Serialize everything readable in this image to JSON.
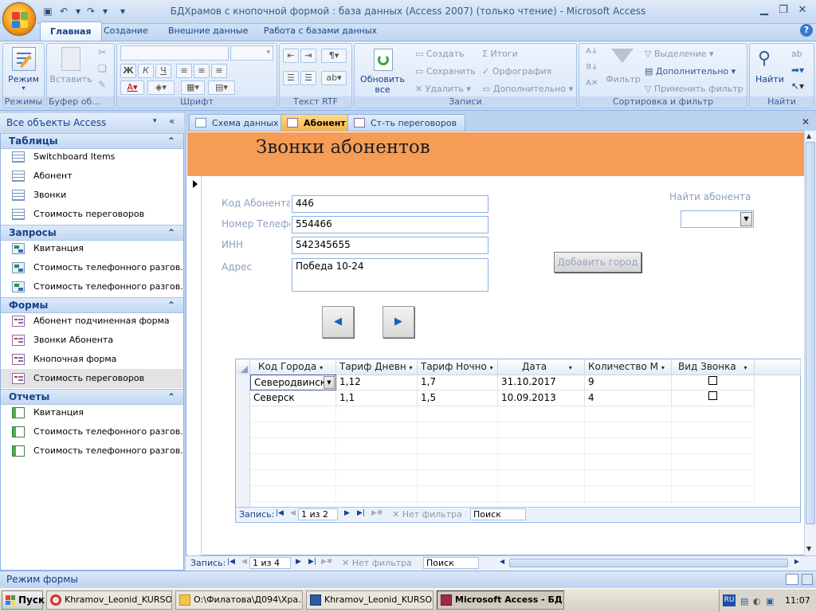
{
  "window": {
    "title": "БДХрамов с кнопочной формой : база данных (Access 2007) (только чтение) - Microsoft Access"
  },
  "ribbon": {
    "tabs": [
      "Главная",
      "Создание",
      "Внешние данные",
      "Работа с базами данных"
    ],
    "groups": {
      "views": {
        "label": "Режимы",
        "button": "Режим"
      },
      "clipboard": {
        "label": "Буфер об...",
        "paste": "Вставить"
      },
      "font": {
        "label": "Шрифт"
      },
      "rtf": {
        "label": "Текст RTF"
      },
      "records": {
        "label": "Записи",
        "refresh": "Обновить",
        "refresh2": "все",
        "new": "Создать",
        "save": "Сохранить",
        "delete": "Удалить",
        "totals": "Итоги",
        "spelling": "Орфография",
        "more": "Дополнительно"
      },
      "sort": {
        "label": "Сортировка и фильтр",
        "filter": "Фильтр",
        "selection": "Выделение",
        "advanced": "Дополнительно",
        "apply": "Применить фильтр"
      },
      "find": {
        "label": "Найти",
        "button": "Найти"
      }
    }
  },
  "nav": {
    "header": "Все объекты Access",
    "sections": [
      {
        "title": "Таблицы",
        "items": [
          "Switchboard Items",
          "Абонент",
          "Звонки",
          "Стоимость переговоров"
        ]
      },
      {
        "title": "Запросы",
        "items": [
          "Квитанция",
          "Стоимость телефонного разгов...",
          "Стоимость телефонного разгов..."
        ]
      },
      {
        "title": "Формы",
        "items": [
          "Абонент подчиненная форма",
          "Звонки Абонента",
          "Кнопочная форма",
          "Стоимость переговоров"
        ]
      },
      {
        "title": "Отчеты",
        "items": [
          "Квитанция",
          "Стоимость телефонного разгов...",
          "Стоимость телефонного разгов..."
        ]
      }
    ]
  },
  "doc_tabs": [
    "Схема данных",
    "Абонент",
    "Ст-ть переговоров"
  ],
  "form": {
    "title": "Звонки абонентов",
    "fields": [
      {
        "label": "Код Абонента",
        "value": "446"
      },
      {
        "label": "Номер Телефона",
        "value": "554466"
      },
      {
        "label": "ИНН",
        "value": "542345655"
      },
      {
        "label": "Адрес",
        "value": "Победа 10-24"
      }
    ],
    "find_label": "Найти абонента",
    "add_city_button": "Добавить город",
    "prev": "◀",
    "next": "▶"
  },
  "subform": {
    "columns": [
      "Код Города",
      "Тариф Дневн",
      "Тариф Ночно",
      "Дата",
      "Количество М",
      "Вид Звонка"
    ],
    "rows": [
      [
        "Северодвинск",
        "1,12",
        "1,7",
        "31.10.2017",
        "9"
      ],
      [
        "Северск",
        "1,1",
        "1,5",
        "10.09.2013",
        "4"
      ]
    ],
    "record_label": "Запись:",
    "record_pos": "1 из 2",
    "no_filter": "Нет фильтра",
    "search": "Поиск"
  },
  "main_record": {
    "record_label": "Запись:",
    "record_pos": "1 из 4",
    "no_filter": "Нет фильтра",
    "search": "Поиск"
  },
  "status": "Режим формы",
  "taskbar": {
    "start": "Пуск",
    "items": [
      "Khramov_Leonid_KURSO...",
      "О:\\Филатова\\Д094\\Хра...",
      "Khramov_Leonid_KURSO...",
      "Microsoft Access - БД..."
    ],
    "lang": "RU",
    "time": "11:07"
  }
}
